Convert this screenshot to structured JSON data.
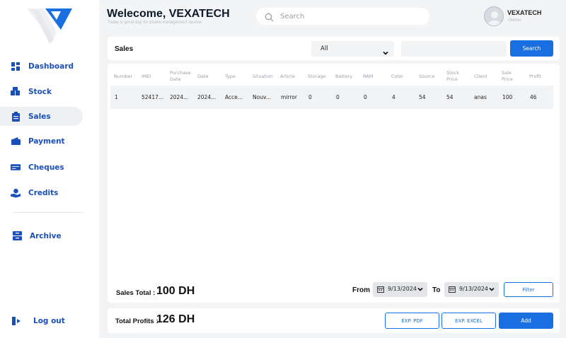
{
  "header": {
    "welcome": "Welecome, VEXATECH",
    "tagline": "Today is great day for phone management service",
    "search_placeholder": "Search",
    "user_name": "VEXATECH",
    "user_role": "Owner"
  },
  "sidebar": {
    "items": [
      {
        "label": "Dashboard",
        "icon": "grid-icon"
      },
      {
        "label": "Stock",
        "icon": "boxes-icon"
      },
      {
        "label": "Sales",
        "icon": "clipboard-icon"
      },
      {
        "label": "Payment",
        "icon": "wallet-icon"
      },
      {
        "label": "Cheques",
        "icon": "cheque-icon"
      },
      {
        "label": "Credits",
        "icon": "hand-coins-icon"
      },
      {
        "label": "Archive",
        "icon": "archive-icon"
      }
    ],
    "active": "Sales",
    "logout_label": "Log out"
  },
  "sales": {
    "title": "Sales",
    "filter_selected": "All",
    "search_button": "Search",
    "columns": [
      "Number",
      "IMEI",
      "Purchase Date",
      "Date",
      "Type",
      "Situation",
      "Article",
      "Storage",
      "Battery",
      "RAM",
      "Color",
      "Source",
      "Stock Price",
      "Client",
      "Sale Price",
      "Profit"
    ],
    "rows": [
      [
        "1",
        "52417...",
        "2024...",
        "2024...",
        "Acce...",
        "Nouv...",
        "mirror",
        "0",
        "0",
        "0",
        "4",
        "54",
        "54",
        "anas",
        "100",
        "46"
      ]
    ],
    "total_label": "Sales Total :",
    "total_value": "100 DH",
    "from_label": "From",
    "to_label": "To",
    "from_date": "9/13/2024",
    "to_date": "9/13/2024",
    "filter_button": "Filter"
  },
  "footer": {
    "profits_label": "Total Profits :",
    "profits_value": "126 DH",
    "exp_pdf": "EXP. PDF",
    "exp_excel": "EXP. EXCEL",
    "add": "Add"
  },
  "colors": {
    "accent": "#1a6fe0",
    "nav_text": "#1a4fb8",
    "background": "#f3f4f6"
  }
}
